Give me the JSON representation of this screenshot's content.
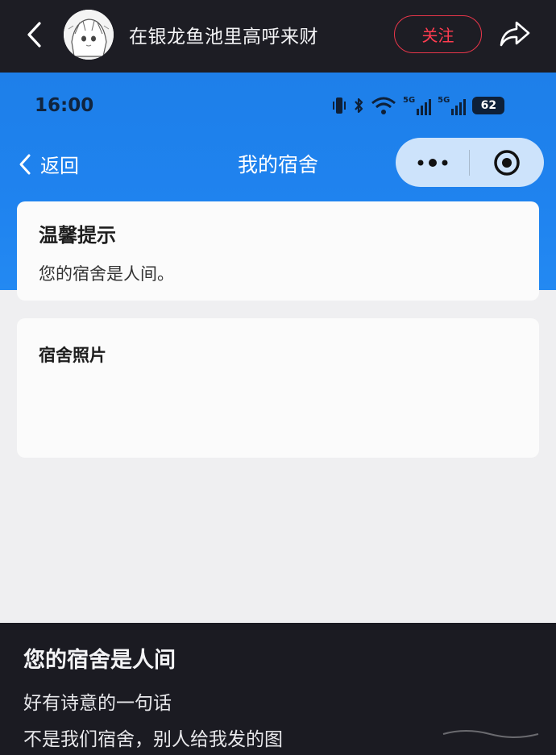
{
  "topbar": {
    "author_name": "在银龙鱼池里高呼来财",
    "follow_label": "关注"
  },
  "screenshot": {
    "status": {
      "time": "16:00",
      "net1": "5G",
      "net2": "5G",
      "battery": "62"
    },
    "nav": {
      "back_label": "返回",
      "title": "我的宿舍"
    },
    "tip_card": {
      "title": "温馨提示",
      "text": "您的宿舍是人间。"
    },
    "photo_card": {
      "title": "宿舍照片"
    }
  },
  "caption": {
    "title": "您的宿舍是人间",
    "line1": "好有诗意的一句话",
    "line2": "不是我们宿舍，别人给我发的图"
  },
  "colors": {
    "header_blue": "#1f83ef",
    "follow_red": "#e8364a",
    "dark_bg": "#1b1b22"
  }
}
